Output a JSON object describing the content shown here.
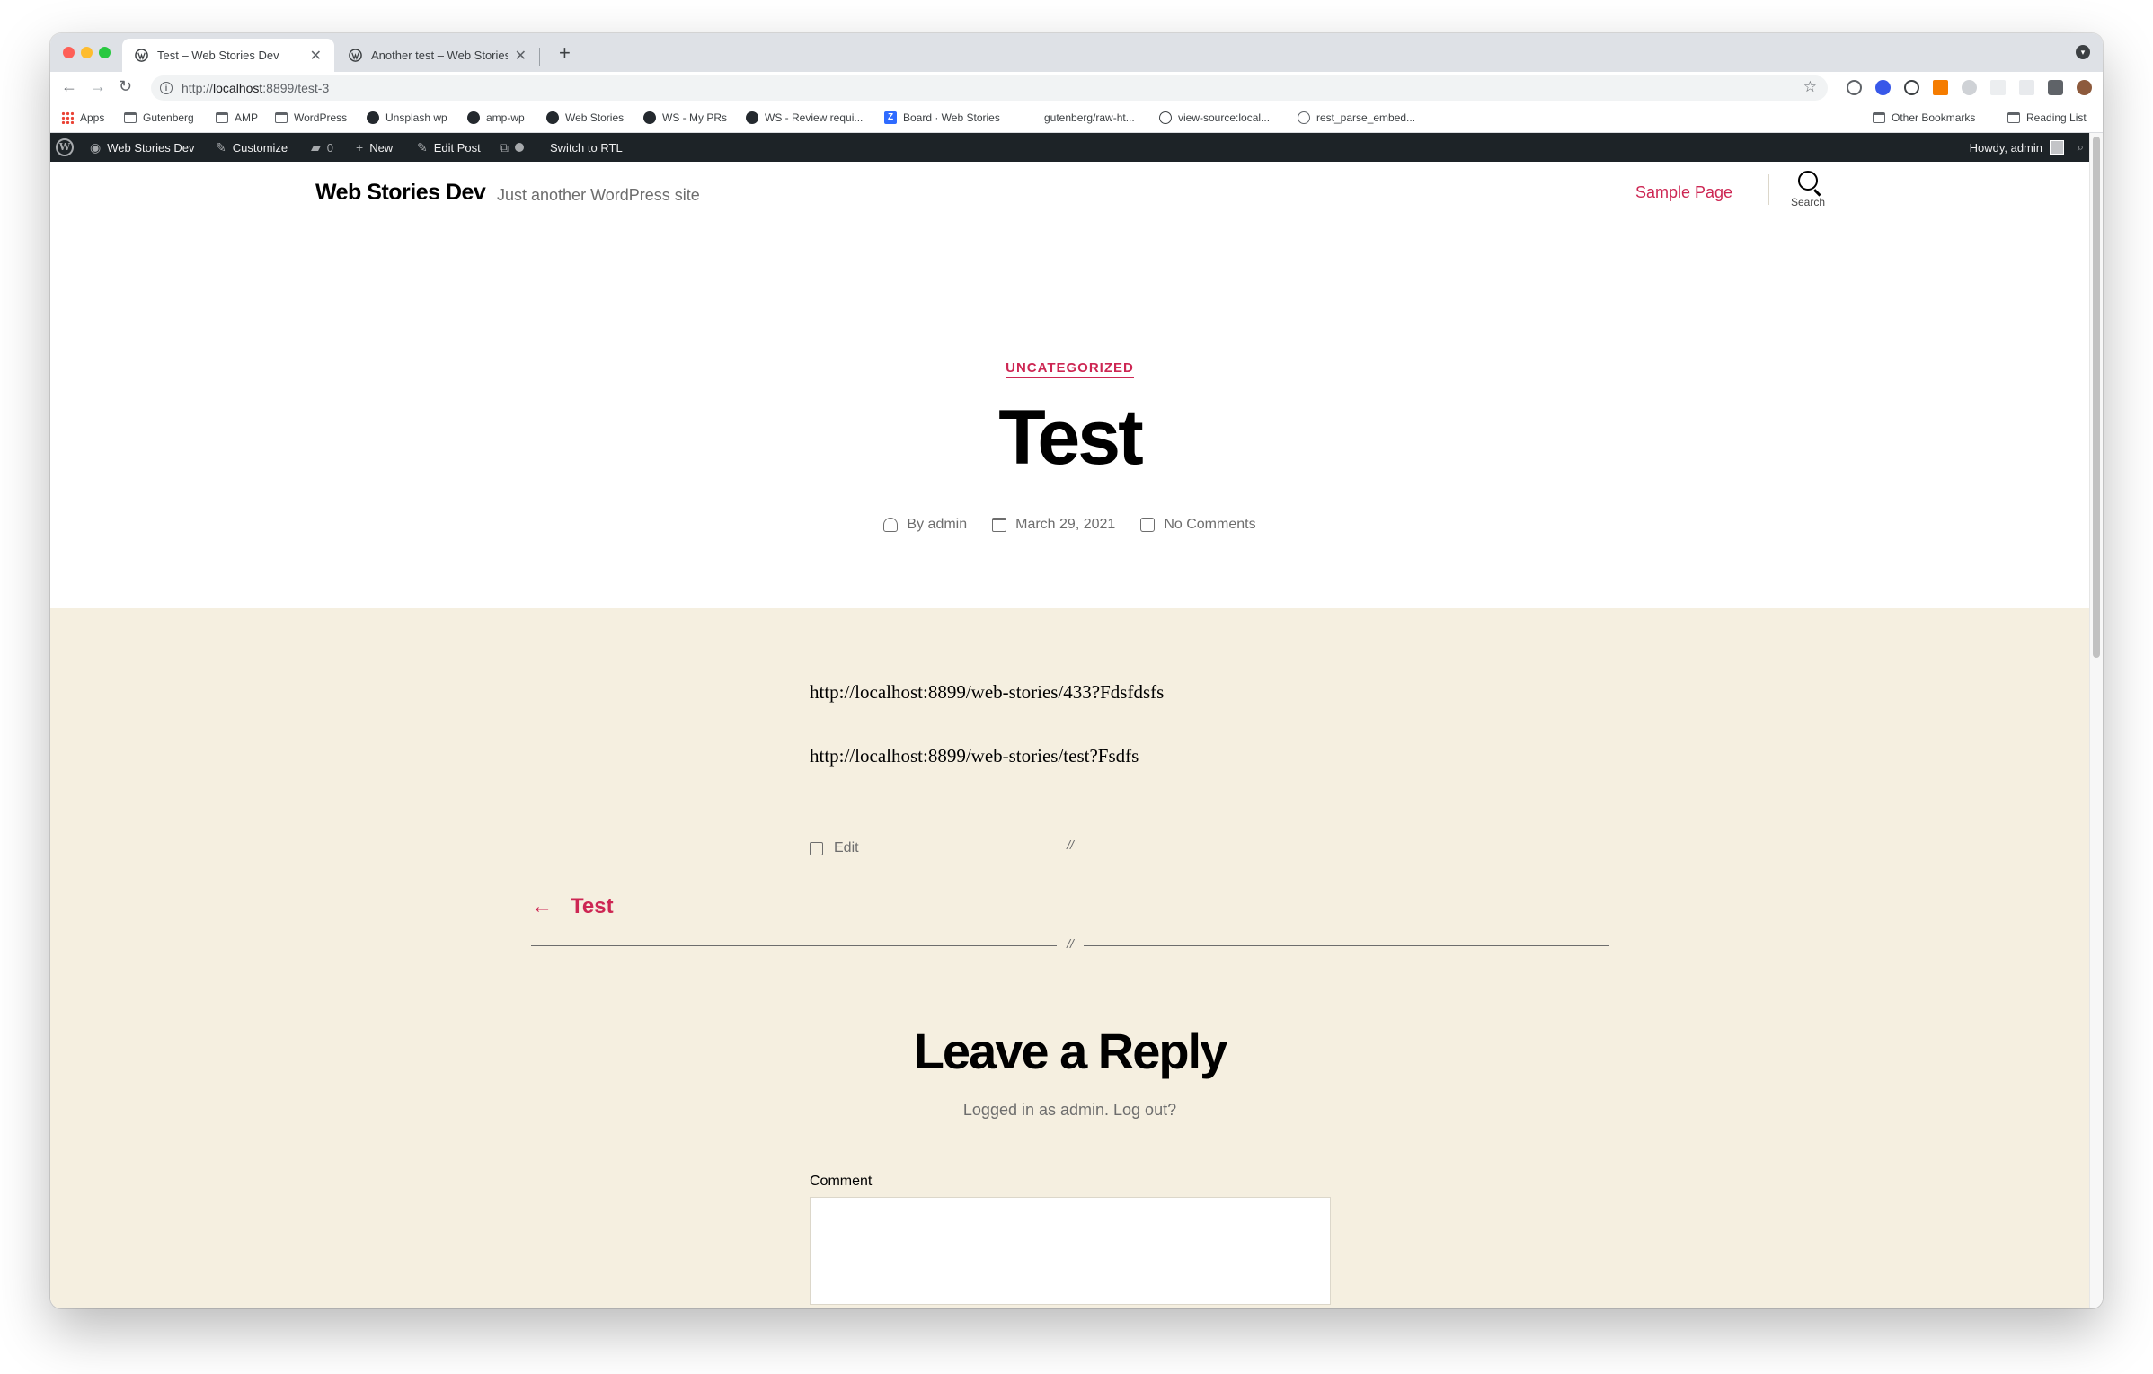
{
  "browser": {
    "tabs": [
      {
        "title": "Test – Web Stories Dev",
        "active": true,
        "close": "✕"
      },
      {
        "title": "Another test – Web Stories Dev",
        "active": false,
        "close": "✕"
      }
    ],
    "new_tab": "+",
    "url_scheme": "http://",
    "url_host": "localhost",
    "url_rest": ":8899/test-3",
    "bookmarks": [
      {
        "label": "Apps",
        "icon": "apps-grid-icon"
      },
      {
        "label": "Gutenberg",
        "icon": "folder-icon"
      },
      {
        "label": "AMP",
        "icon": "folder-icon"
      },
      {
        "label": "WordPress",
        "icon": "folder-icon"
      },
      {
        "label": "Unsplash wp",
        "icon": "github-icon"
      },
      {
        "label": "amp-wp",
        "icon": "github-icon"
      },
      {
        "label": "Web Stories",
        "icon": "github-icon"
      },
      {
        "label": "WS - My PRs",
        "icon": "github-icon"
      },
      {
        "label": "WS - Review requi...",
        "icon": "github-icon"
      },
      {
        "label": "Board · Web Stories",
        "icon": "zenhub-icon"
      },
      {
        "label": "gutenberg/raw-ht...",
        "icon": "none"
      },
      {
        "label": "view-source:local...",
        "icon": "globe-icon"
      },
      {
        "label": "rest_parse_embed...",
        "icon": "wordpress-icon"
      }
    ],
    "other_bookmarks": "Other Bookmarks",
    "reading_list": "Reading List"
  },
  "adminbar": {
    "site_name": "Web Stories Dev",
    "customize": "Customize",
    "comments_count": "0",
    "new": "New",
    "edit_post": "Edit Post",
    "switch_rtl": "Switch to RTL",
    "howdy": "Howdy, admin"
  },
  "site": {
    "title": "Web Stories Dev",
    "description": "Just another WordPress site",
    "menu_item": "Sample Page",
    "search_label": "Search"
  },
  "post": {
    "category": "UNCATEGORIZED",
    "title": "Test",
    "author": "By admin",
    "date": "March 29, 2021",
    "comments": "No Comments",
    "urls": [
      "http://localhost:8899/web-stories/433?Fdsfdsfs",
      "http://localhost:8899/web-stories/test?Fsdfs"
    ],
    "edit": "Edit",
    "divider": "//",
    "prev_arrow": "←",
    "prev_title": "Test"
  },
  "comments": {
    "title": "Leave a Reply",
    "logged_in": "Logged in as admin. Log out?",
    "comment_label": "Comment"
  },
  "colors": {
    "accent": "#cd2653",
    "content_bg": "#f5efe0",
    "adminbar_bg": "#1d2327"
  }
}
